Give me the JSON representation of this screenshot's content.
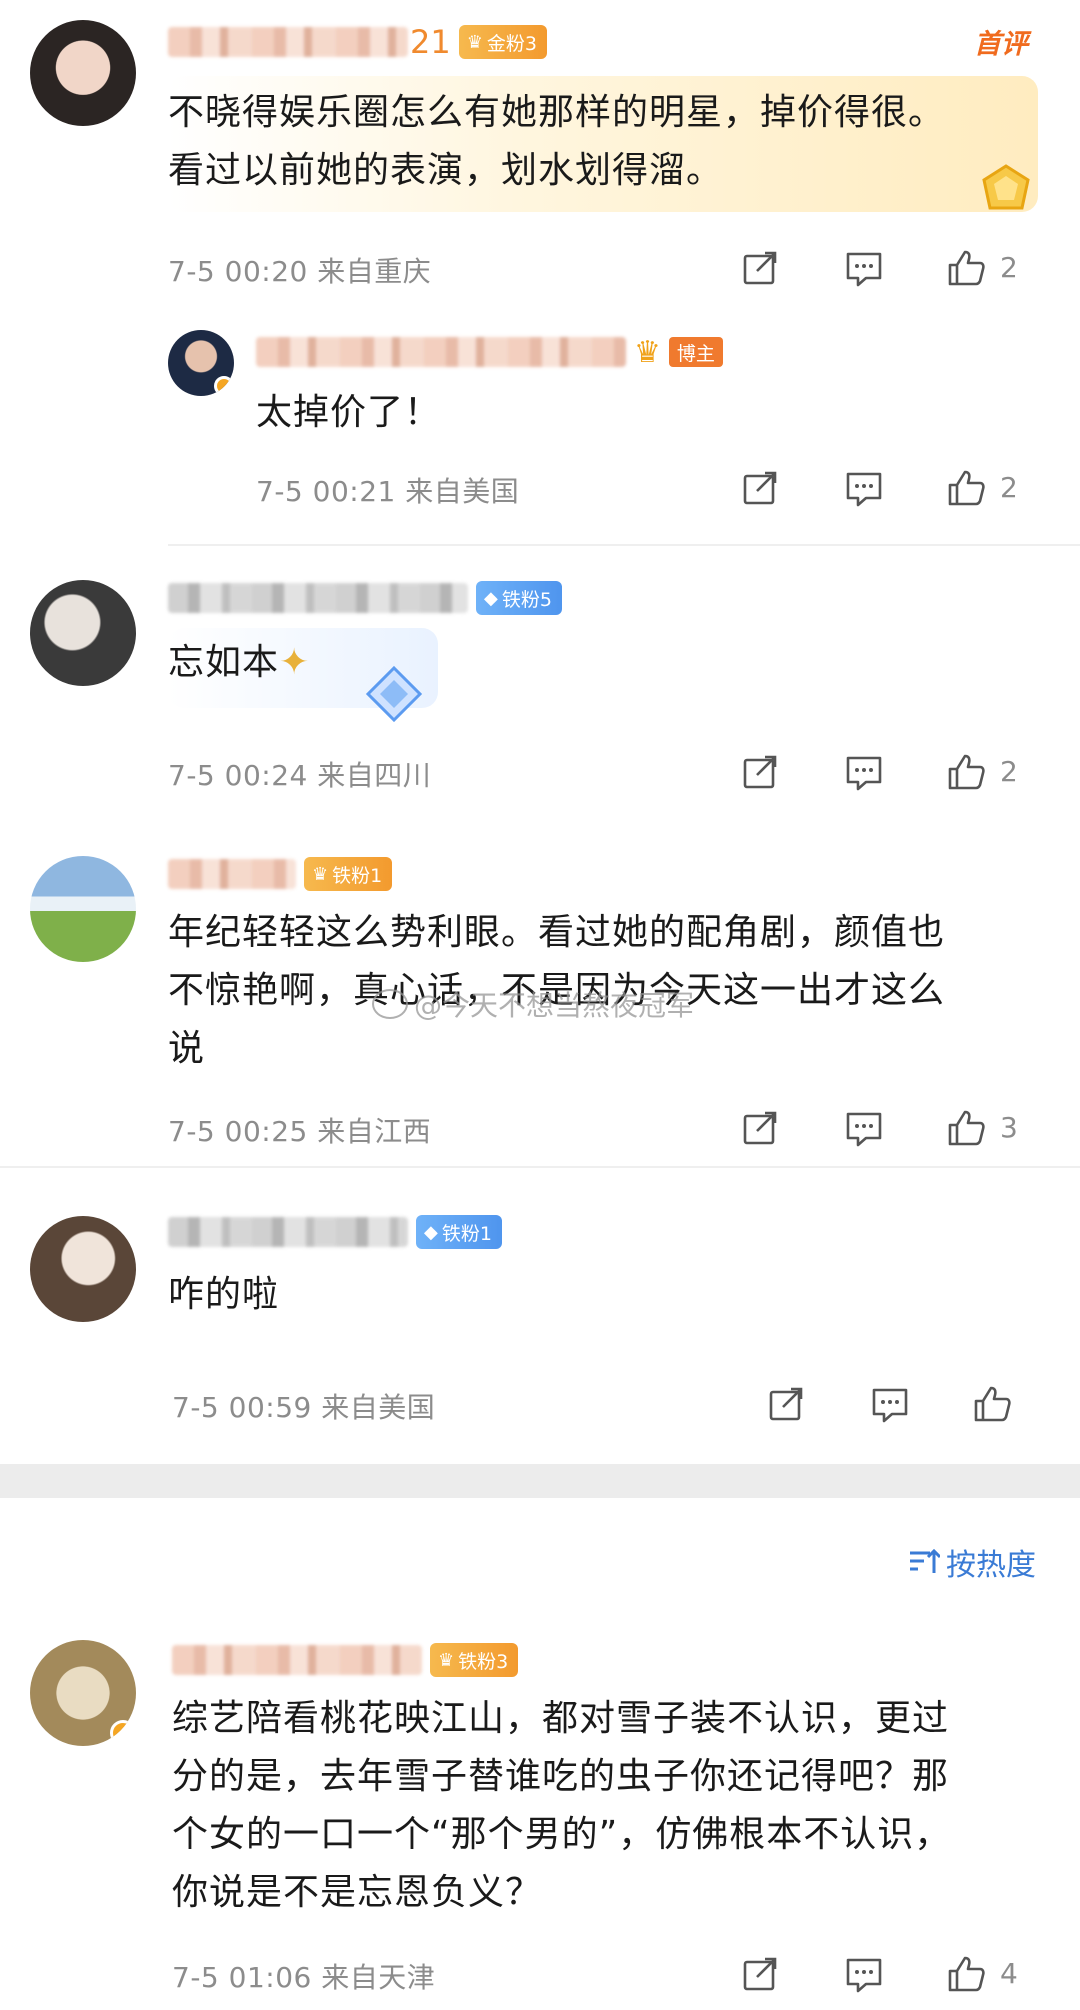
{
  "comments": [
    {
      "name_suffix": "21",
      "badge": "金粉3",
      "tag": "首评",
      "lines": [
        "不晓得娱乐圈怎么有她那样的明星，掉价得很。",
        "看过以前她的表演，划水划得溜。"
      ],
      "time": "7-5 00:20",
      "location": "来自重庆",
      "likes": "2"
    },
    {
      "badge": "博主",
      "lines": [
        "太掉价了！"
      ],
      "time": "7-5 00:21",
      "location": "来自美国",
      "likes": "2"
    },
    {
      "badge": "铁粉5",
      "lines": [
        "忘如本"
      ],
      "time": "7-5 00:24",
      "location": "来自四川",
      "likes": "2"
    },
    {
      "badge": "铁粉1",
      "lines": [
        "年纪轻轻这么势利眼。看过她的配角剧，颜值也",
        "不惊艳啊，真心话，不是因为今天这一出才这么",
        "说"
      ],
      "time": "7-5 00:25",
      "location": "来自江西",
      "likes": "3"
    },
    {
      "badge": "铁粉1",
      "lines": [
        "咋的啦"
      ],
      "time": "7-5 00:59",
      "location": "来自美国",
      "likes": ""
    },
    {
      "badge": "铁粉3",
      "lines": [
        "综艺陪看桃花映江山，都对雪子装不认识，更过",
        "分的是，去年雪子替谁吃的虫子你还记得吧？那",
        "个女的一口一个“那个男的”，仿佛根本不认识，",
        "你说是不是忘恩负义？"
      ],
      "time": "7-5 01:06",
      "location": "来自天津",
      "likes": "4"
    }
  ],
  "sort": {
    "icon": "sort-icon",
    "label": "按热度"
  },
  "watermark": "@今天不想当熬夜冠军",
  "icons": {
    "share": "share-icon",
    "reply": "reply-icon",
    "like": "thumbs-up-icon"
  },
  "colors": {
    "accent_orange": "#f06b1e",
    "link_blue": "#3a7bd5",
    "meta_gray": "#8c8c8c"
  }
}
